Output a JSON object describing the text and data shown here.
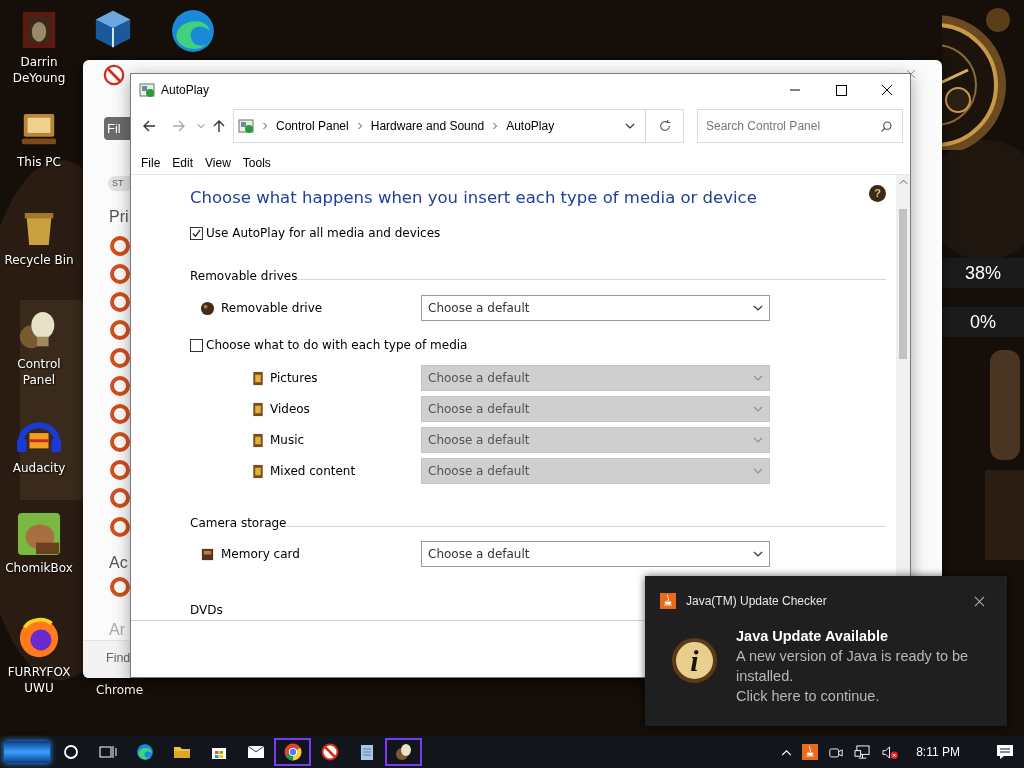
{
  "desktop": {
    "icons": [
      {
        "kind": "frame",
        "label": "Darrin DeYoung"
      },
      {
        "kind": "monitor",
        "label": "This PC"
      },
      {
        "kind": "bin",
        "label": "Recycle Bin"
      },
      {
        "kind": "bulb",
        "label": "Control Panel"
      },
      {
        "kind": "headphones",
        "label": "Audacity"
      },
      {
        "kind": "hamster",
        "label": "ChomikBox"
      },
      {
        "kind": "globe",
        "label": "FURRYFOX UWU"
      }
    ],
    "top_icons": [
      {
        "kind": "cube"
      },
      {
        "kind": "edge"
      }
    ],
    "chrome_label": "Chrome",
    "gadget_readings": [
      "38%",
      "0%"
    ]
  },
  "background_window": {
    "button": "Fil",
    "chip": "ST",
    "headings": [
      "Pri",
      "Ac",
      "Ar"
    ],
    "find_label": "Find",
    "toggles": [
      {
        "on": false
      },
      {
        "on": false
      },
      {
        "on": false
      },
      {
        "on": false
      },
      {
        "on": false
      },
      {
        "on": false
      },
      {
        "on": false
      },
      {
        "on": false
      },
      {
        "on": false
      },
      {
        "on": false
      },
      {
        "on": false
      },
      {
        "on": false
      }
    ]
  },
  "autoplay": {
    "title": "AutoPlay",
    "breadcrumb": [
      "Control Panel",
      "Hardware and Sound",
      "AutoPlay"
    ],
    "search": {
      "placeholder": "Search Control Panel"
    },
    "menu": [
      "File",
      "Edit",
      "View",
      "Tools"
    ],
    "heading": "Choose what happens when you insert each type of media or device",
    "help_glyph": "?",
    "use_autoplay": {
      "label": "Use AutoPlay for all media and devices",
      "checked": true
    },
    "sections": [
      {
        "title": "Removable drives",
        "items": [
          {
            "kind": "device",
            "label": "Removable drive",
            "value": "Choose a default",
            "disabled": false
          },
          {
            "kind": "checkbox",
            "label": "Choose what to do with each type of media",
            "checked": false
          },
          {
            "kind": "media",
            "label": "Pictures",
            "value": "Choose a default",
            "disabled": true
          },
          {
            "kind": "media",
            "label": "Videos",
            "value": "Choose a default",
            "disabled": true
          },
          {
            "kind": "media",
            "label": "Music",
            "value": "Choose a default",
            "disabled": true
          },
          {
            "kind": "media",
            "label": "Mixed content",
            "value": "Choose a default",
            "disabled": true
          }
        ]
      },
      {
        "title": "Camera storage",
        "items": [
          {
            "kind": "device",
            "label": "Memory card",
            "value": "Choose a default",
            "disabled": false
          }
        ]
      },
      {
        "title": "DVDs"
      }
    ]
  },
  "toast": {
    "app": "Java(TM) Update Checker",
    "icon_glyph": "i",
    "title": "Java Update Available",
    "body": "A new version of Java is ready to be installed.",
    "action": "Click here to continue."
  },
  "taskbar": {
    "apps": [
      {
        "kind": "cortana",
        "highlighted": false
      },
      {
        "kind": "taskview",
        "highlighted": false
      },
      {
        "kind": "edge",
        "highlighted": false
      },
      {
        "kind": "explorer",
        "highlighted": false
      },
      {
        "kind": "store",
        "highlighted": false
      },
      {
        "kind": "mail",
        "highlighted": false
      },
      {
        "kind": "chrome",
        "highlighted": true
      },
      {
        "kind": "ball",
        "highlighted": false
      },
      {
        "kind": "notepad",
        "highlighted": false
      },
      {
        "kind": "bulb",
        "highlighted": true
      }
    ],
    "clock": "8:11 PM"
  }
}
